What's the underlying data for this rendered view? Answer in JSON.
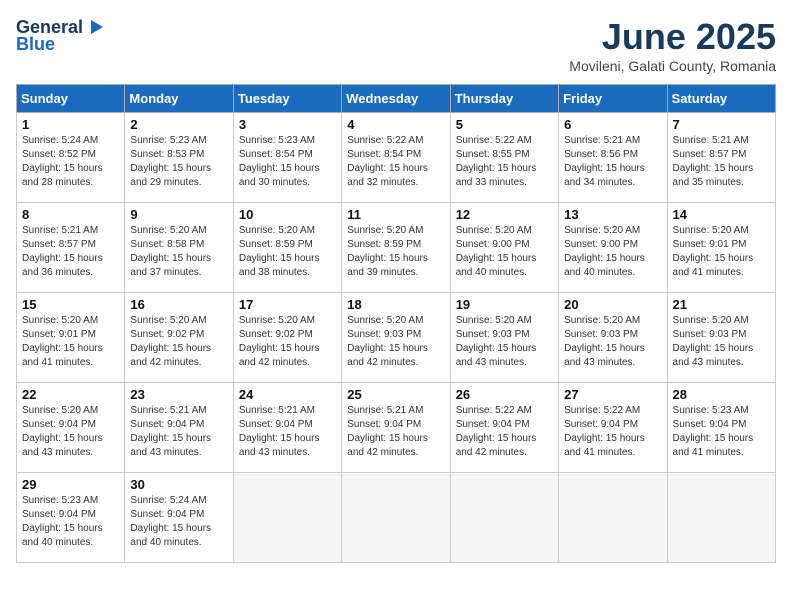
{
  "header": {
    "logo_line1": "General",
    "logo_line2": "Blue",
    "month_year": "June 2025",
    "location": "Movileni, Galati County, Romania"
  },
  "weekdays": [
    "Sunday",
    "Monday",
    "Tuesday",
    "Wednesday",
    "Thursday",
    "Friday",
    "Saturday"
  ],
  "weeks": [
    [
      {
        "day": 1,
        "sunrise": "5:24 AM",
        "sunset": "8:52 PM",
        "daylight": "15 hours and 28 minutes."
      },
      {
        "day": 2,
        "sunrise": "5:23 AM",
        "sunset": "8:53 PM",
        "daylight": "15 hours and 29 minutes."
      },
      {
        "day": 3,
        "sunrise": "5:23 AM",
        "sunset": "8:54 PM",
        "daylight": "15 hours and 30 minutes."
      },
      {
        "day": 4,
        "sunrise": "5:22 AM",
        "sunset": "8:54 PM",
        "daylight": "15 hours and 32 minutes."
      },
      {
        "day": 5,
        "sunrise": "5:22 AM",
        "sunset": "8:55 PM",
        "daylight": "15 hours and 33 minutes."
      },
      {
        "day": 6,
        "sunrise": "5:21 AM",
        "sunset": "8:56 PM",
        "daylight": "15 hours and 34 minutes."
      },
      {
        "day": 7,
        "sunrise": "5:21 AM",
        "sunset": "8:57 PM",
        "daylight": "15 hours and 35 minutes."
      }
    ],
    [
      {
        "day": 8,
        "sunrise": "5:21 AM",
        "sunset": "8:57 PM",
        "daylight": "15 hours and 36 minutes."
      },
      {
        "day": 9,
        "sunrise": "5:20 AM",
        "sunset": "8:58 PM",
        "daylight": "15 hours and 37 minutes."
      },
      {
        "day": 10,
        "sunrise": "5:20 AM",
        "sunset": "8:59 PM",
        "daylight": "15 hours and 38 minutes."
      },
      {
        "day": 11,
        "sunrise": "5:20 AM",
        "sunset": "8:59 PM",
        "daylight": "15 hours and 39 minutes."
      },
      {
        "day": 12,
        "sunrise": "5:20 AM",
        "sunset": "9:00 PM",
        "daylight": "15 hours and 40 minutes."
      },
      {
        "day": 13,
        "sunrise": "5:20 AM",
        "sunset": "9:00 PM",
        "daylight": "15 hours and 40 minutes."
      },
      {
        "day": 14,
        "sunrise": "5:20 AM",
        "sunset": "9:01 PM",
        "daylight": "15 hours and 41 minutes."
      }
    ],
    [
      {
        "day": 15,
        "sunrise": "5:20 AM",
        "sunset": "9:01 PM",
        "daylight": "15 hours and 41 minutes."
      },
      {
        "day": 16,
        "sunrise": "5:20 AM",
        "sunset": "9:02 PM",
        "daylight": "15 hours and 42 minutes."
      },
      {
        "day": 17,
        "sunrise": "5:20 AM",
        "sunset": "9:02 PM",
        "daylight": "15 hours and 42 minutes."
      },
      {
        "day": 18,
        "sunrise": "5:20 AM",
        "sunset": "9:03 PM",
        "daylight": "15 hours and 42 minutes."
      },
      {
        "day": 19,
        "sunrise": "5:20 AM",
        "sunset": "9:03 PM",
        "daylight": "15 hours and 43 minutes."
      },
      {
        "day": 20,
        "sunrise": "5:20 AM",
        "sunset": "9:03 PM",
        "daylight": "15 hours and 43 minutes."
      },
      {
        "day": 21,
        "sunrise": "5:20 AM",
        "sunset": "9:03 PM",
        "daylight": "15 hours and 43 minutes."
      }
    ],
    [
      {
        "day": 22,
        "sunrise": "5:20 AM",
        "sunset": "9:04 PM",
        "daylight": "15 hours and 43 minutes."
      },
      {
        "day": 23,
        "sunrise": "5:21 AM",
        "sunset": "9:04 PM",
        "daylight": "15 hours and 43 minutes."
      },
      {
        "day": 24,
        "sunrise": "5:21 AM",
        "sunset": "9:04 PM",
        "daylight": "15 hours and 43 minutes."
      },
      {
        "day": 25,
        "sunrise": "5:21 AM",
        "sunset": "9:04 PM",
        "daylight": "15 hours and 42 minutes."
      },
      {
        "day": 26,
        "sunrise": "5:22 AM",
        "sunset": "9:04 PM",
        "daylight": "15 hours and 42 minutes."
      },
      {
        "day": 27,
        "sunrise": "5:22 AM",
        "sunset": "9:04 PM",
        "daylight": "15 hours and 41 minutes."
      },
      {
        "day": 28,
        "sunrise": "5:23 AM",
        "sunset": "9:04 PM",
        "daylight": "15 hours and 41 minutes."
      }
    ],
    [
      {
        "day": 29,
        "sunrise": "5:23 AM",
        "sunset": "9:04 PM",
        "daylight": "15 hours and 40 minutes."
      },
      {
        "day": 30,
        "sunrise": "5:24 AM",
        "sunset": "9:04 PM",
        "daylight": "15 hours and 40 minutes."
      },
      null,
      null,
      null,
      null,
      null
    ]
  ]
}
